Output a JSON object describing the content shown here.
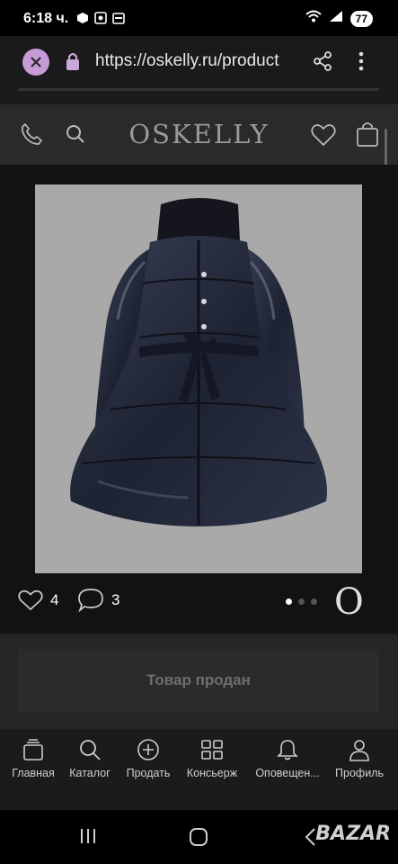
{
  "status_bar": {
    "time": "6:18 ч.",
    "battery": "77"
  },
  "browser": {
    "url": "https://oskelly.ru/product"
  },
  "site": {
    "logo": "OSKELLY"
  },
  "product": {
    "likes": "4",
    "comments": "3",
    "image_count": 3,
    "active_image": 1,
    "brand_mark": "O",
    "sold_label": "Товар продан"
  },
  "nav": {
    "items": [
      {
        "label": "Главная",
        "icon": "home-icon"
      },
      {
        "label": "Каталог",
        "icon": "search-icon"
      },
      {
        "label": "Продать",
        "icon": "plus-circle-icon"
      },
      {
        "label": "Консьерж",
        "icon": "grid-icon"
      },
      {
        "label": "Оповещен...",
        "icon": "bell-icon"
      },
      {
        "label": "Профиль",
        "icon": "user-icon"
      }
    ]
  },
  "watermark": "BAZAR",
  "colors": {
    "accent_close": "#c79bd6",
    "header_bg": "#2a2a2a",
    "image_bg": "#a9a9a9"
  }
}
